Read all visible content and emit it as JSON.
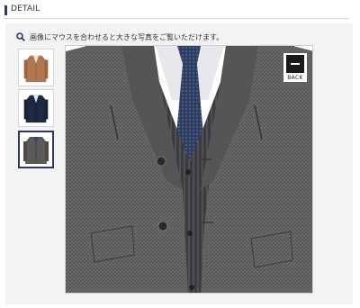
{
  "section": {
    "title": "DETAIL"
  },
  "hint": {
    "text": "画像にマウスを合わせると大きな写真をご覧いただけます。"
  },
  "thumbnails": [
    {
      "icon": "camel-coat-thumbnail",
      "color": "#b07850"
    },
    {
      "icon": "navy-coat-thumbnail",
      "color": "#1e2a44"
    },
    {
      "icon": "gray-coat-thumbnail",
      "color": "#5a5a5a"
    }
  ],
  "viewer": {
    "back_label": "BACK",
    "image": "gray-herringbone-coat-closeup"
  },
  "colors": {
    "accent": "#2a3a66",
    "panel": "#f3f3f3"
  }
}
